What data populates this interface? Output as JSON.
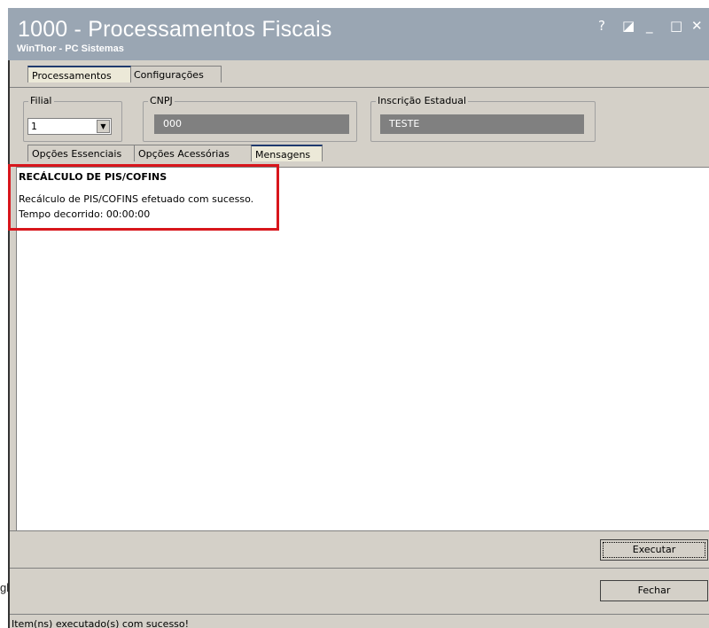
{
  "window": {
    "title": "1000 - Processamentos Fiscais",
    "subtitle": "WinThor - PC Sistemas",
    "controls": {
      "help": "?",
      "restore": "◪",
      "minimize": "_",
      "maximize": "□",
      "close": "✕"
    }
  },
  "outside_fragment": "gl",
  "top_tabs": [
    {
      "label": "Processamentos",
      "active": true
    },
    {
      "label": "Configurações",
      "active": false
    }
  ],
  "filters": {
    "filial": {
      "label": "Filial",
      "value": "1"
    },
    "cnpj": {
      "label": "CNPJ",
      "value": "000"
    },
    "inscricao": {
      "label": "Inscrição Estadual",
      "value": "TESTE"
    }
  },
  "sub_tabs": [
    {
      "label": "Opções Essenciais",
      "active": false
    },
    {
      "label": "Opções Acessórias",
      "active": false
    },
    {
      "label": "Mensagens",
      "active": true
    }
  ],
  "messages": {
    "title": "RECÁLCULO DE PIS/COFINS",
    "lines": [
      "Recálculo de PIS/COFINS efetuado com sucesso.",
      "Tempo decorrido: 00:00:00"
    ]
  },
  "buttons": {
    "execute": "Executar",
    "close": "Fechar"
  },
  "status": "Item(ns) executado(s) com sucesso!",
  "colors": {
    "titlebar": "#9aa6b3",
    "highlight": "#d8161c",
    "window": "#d4d0c8",
    "field": "#808080"
  }
}
